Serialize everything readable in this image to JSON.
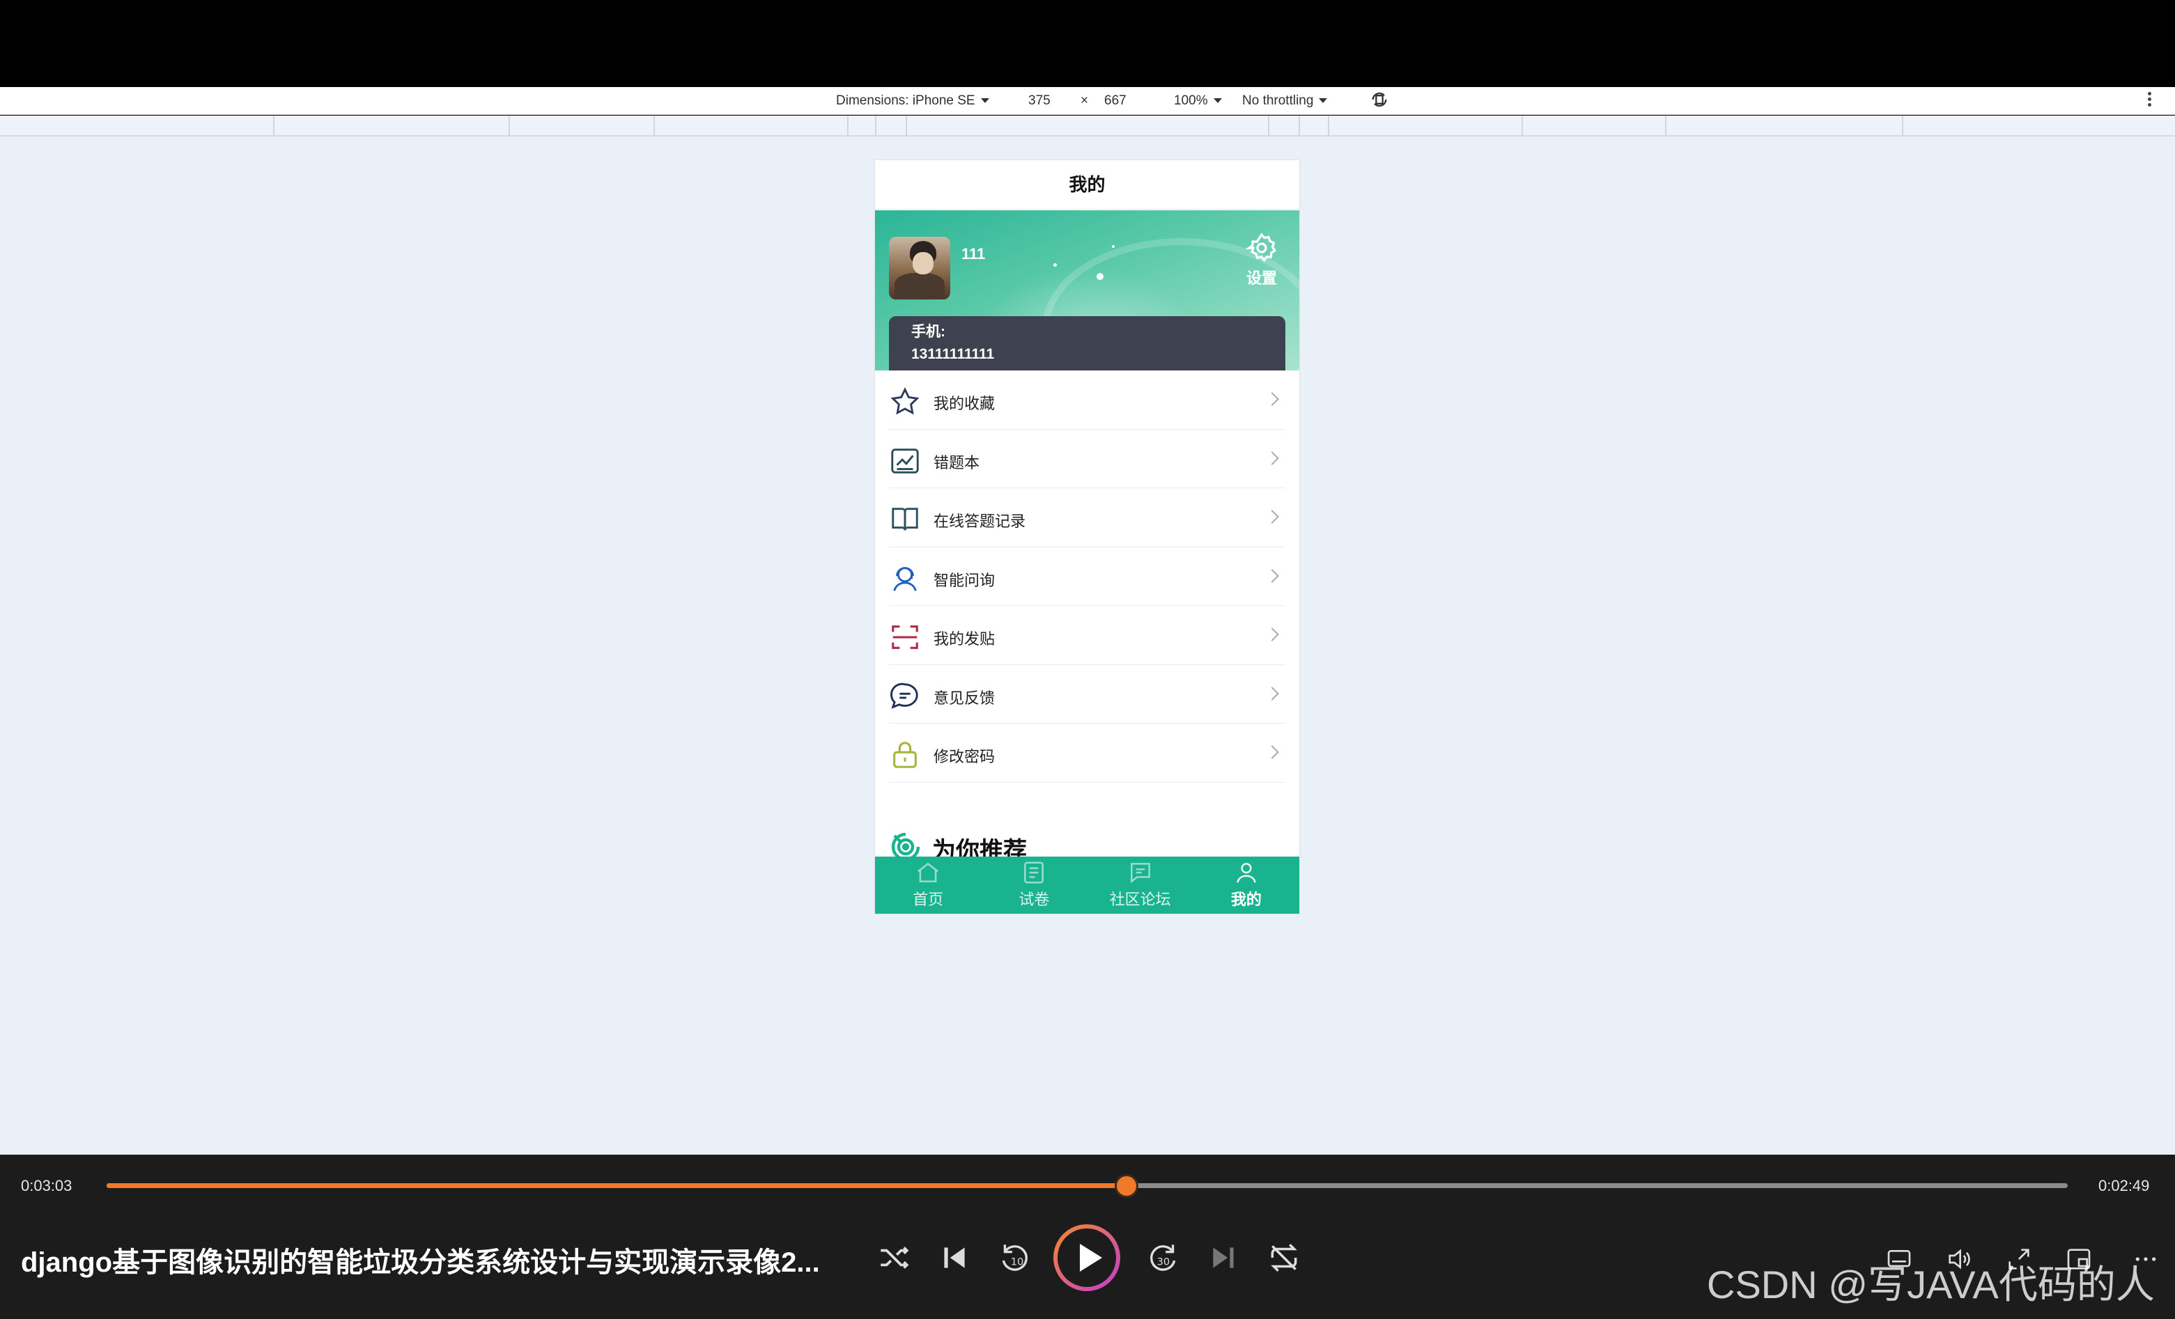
{
  "devtools": {
    "dimensions_label": "Dimensions: iPhone SE",
    "width_value": "375",
    "times": "×",
    "height_value": "667",
    "zoom": "100%",
    "throttling": "No throttling"
  },
  "app": {
    "nav_title": "我的",
    "profile": {
      "username": "111",
      "settings_label": "设置",
      "phone_label": "手机:",
      "phone_value": "13111111111"
    },
    "menu": [
      {
        "label": "我的收藏",
        "icon": "star-icon"
      },
      {
        "label": "错题本",
        "icon": "chart-icon"
      },
      {
        "label": "在线答题记录",
        "icon": "book-icon"
      },
      {
        "label": "智能问询",
        "icon": "agent-icon"
      },
      {
        "label": "我的发贴",
        "icon": "scan-icon"
      },
      {
        "label": "意见反馈",
        "icon": "chat-icon"
      },
      {
        "label": "修改密码",
        "icon": "lock-icon"
      }
    ],
    "recommend_title": "为你推荐",
    "tabs": [
      {
        "label": "首页",
        "icon": "home-icon",
        "active": false
      },
      {
        "label": "试卷",
        "icon": "paper-icon",
        "active": false
      },
      {
        "label": "社区论坛",
        "icon": "forum-icon",
        "active": false
      },
      {
        "label": "我的",
        "icon": "user-icon",
        "active": true
      }
    ],
    "colors": {
      "brand": "#1ab38f",
      "phone_card": "#3e4150"
    }
  },
  "player": {
    "elapsed": "0:03:03",
    "remaining": "0:02:49",
    "progress": 0.52,
    "title": "django基于图像识别的智能垃圾分类系统设计与实现演示录像2...",
    "accent": "#f07a2a"
  },
  "watermark": "CSDN @写JAVA代码的人"
}
